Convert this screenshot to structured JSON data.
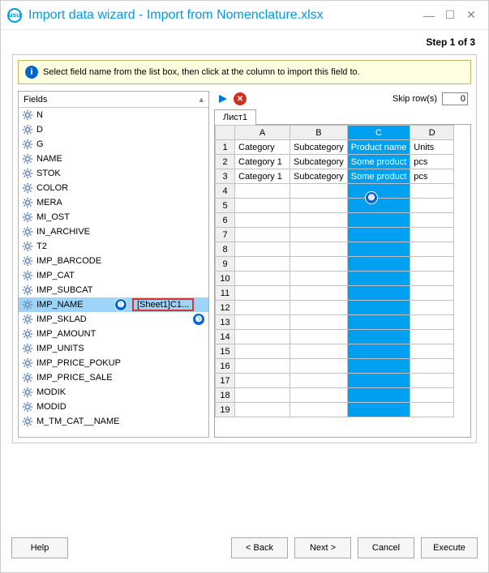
{
  "window": {
    "title": "Import data wizard - Import from Nomenclature.xlsx"
  },
  "step": "Step 1 of 3",
  "info": "Select field name from the list box, then click at the column to import this field to.",
  "fieldsHeader": "Fields",
  "fields": [
    {
      "name": "N"
    },
    {
      "name": "D"
    },
    {
      "name": "G"
    },
    {
      "name": "NAME"
    },
    {
      "name": "STOK"
    },
    {
      "name": "COLOR"
    },
    {
      "name": "MERA"
    },
    {
      "name": "MI_OST"
    },
    {
      "name": "IN_ARCHIVE"
    },
    {
      "name": "T2"
    },
    {
      "name": "IMP_BARCODE"
    },
    {
      "name": "IMP_CAT"
    },
    {
      "name": "IMP_SUBCAT"
    },
    {
      "name": "IMP_NAME",
      "selected": true,
      "mapping": "[Sheet1]C1..."
    },
    {
      "name": "IMP_SKLAD"
    },
    {
      "name": "IMP_AMOUNT"
    },
    {
      "name": "IMP_UNITS"
    },
    {
      "name": "IMP_PRICE_POKUP"
    },
    {
      "name": "IMP_PRICE_SALE"
    },
    {
      "name": "MODIK"
    },
    {
      "name": "MODID"
    },
    {
      "name": "M_TM_CAT__NAME"
    }
  ],
  "skipRows": {
    "label": "Skip row(s)",
    "value": "0"
  },
  "sheetTab": "Лист1",
  "columns": [
    "A",
    "B",
    "C",
    "D"
  ],
  "selectedColumn": "C",
  "rows": [
    {
      "n": 1,
      "cells": [
        "Category",
        "Subcategory",
        "Product name",
        "Units"
      ]
    },
    {
      "n": 2,
      "cells": [
        "Category 1",
        "Subcategory",
        "Some product",
        "pcs"
      ]
    },
    {
      "n": 3,
      "cells": [
        "Category 1",
        "Subcategory",
        "Some product",
        "pcs"
      ]
    },
    {
      "n": 4,
      "cells": [
        "",
        "",
        "",
        ""
      ]
    },
    {
      "n": 5,
      "cells": [
        "",
        "",
        "",
        ""
      ]
    },
    {
      "n": 6,
      "cells": [
        "",
        "",
        "",
        ""
      ]
    },
    {
      "n": 7,
      "cells": [
        "",
        "",
        "",
        ""
      ]
    },
    {
      "n": 8,
      "cells": [
        "",
        "",
        "",
        ""
      ]
    },
    {
      "n": 9,
      "cells": [
        "",
        "",
        "",
        ""
      ]
    },
    {
      "n": 10,
      "cells": [
        "",
        "",
        "",
        ""
      ]
    },
    {
      "n": 11,
      "cells": [
        "",
        "",
        "",
        ""
      ]
    },
    {
      "n": 12,
      "cells": [
        "",
        "",
        "",
        ""
      ]
    },
    {
      "n": 13,
      "cells": [
        "",
        "",
        "",
        ""
      ]
    },
    {
      "n": 14,
      "cells": [
        "",
        "",
        "",
        ""
      ]
    },
    {
      "n": 15,
      "cells": [
        "",
        "",
        "",
        ""
      ]
    },
    {
      "n": 16,
      "cells": [
        "",
        "",
        "",
        ""
      ]
    },
    {
      "n": 17,
      "cells": [
        "",
        "",
        "",
        ""
      ]
    },
    {
      "n": 18,
      "cells": [
        "",
        "",
        "",
        ""
      ]
    },
    {
      "n": 19,
      "cells": [
        "",
        "",
        "",
        ""
      ]
    }
  ],
  "buttons": {
    "help": "Help",
    "back": "< Back",
    "next": "Next >",
    "cancel": "Cancel",
    "execute": "Execute"
  },
  "annotations": {
    "one": "❶",
    "two": "❷",
    "three": "❸"
  }
}
